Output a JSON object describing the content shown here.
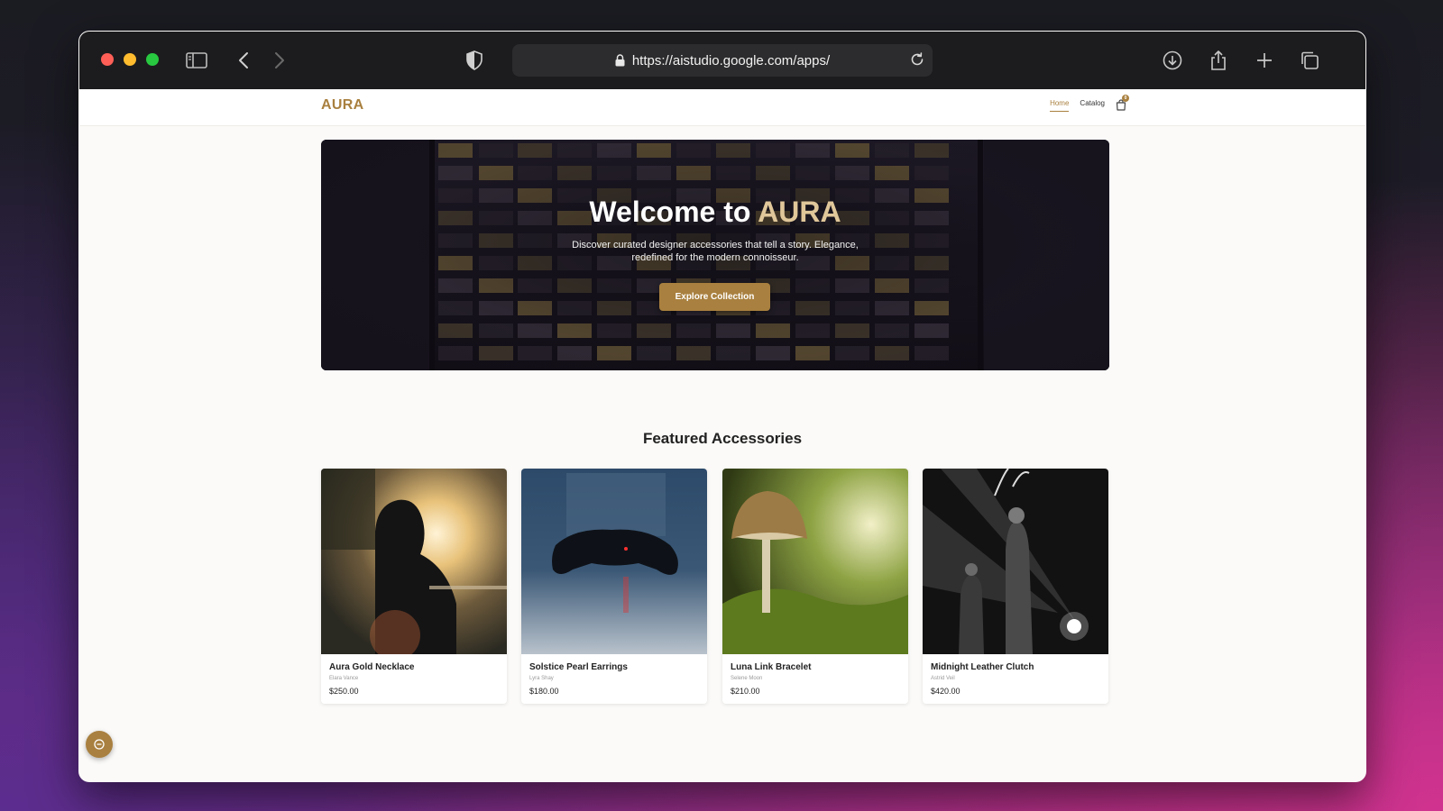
{
  "browser": {
    "url": "https://aistudio.google.com/apps/",
    "icons": [
      "sidebar-icon",
      "back-icon",
      "forward-icon",
      "shield-icon",
      "lock-icon",
      "reload-icon",
      "download-icon",
      "share-icon",
      "new-tab-icon",
      "tabs-icon"
    ]
  },
  "site": {
    "logo": "AURA",
    "nav": {
      "home": "Home",
      "catalog": "Catalog",
      "cart_count": "0"
    }
  },
  "hero": {
    "title_prefix": "Welcome to ",
    "title_accent": "AURA",
    "subtitle": "Discover curated designer accessories that tell a story. Elegance, redefined for the modern connoisseur.",
    "cta": "Explore Collection"
  },
  "featured": {
    "title": "Featured Accessories",
    "products": [
      {
        "name": "Aura Gold Necklace",
        "designer": "Elara Vance",
        "price": "$250.00"
      },
      {
        "name": "Solstice Pearl Earrings",
        "designer": "Lyra Shay",
        "price": "$180.00"
      },
      {
        "name": "Luna Link Bracelet",
        "designer": "Selene Moon",
        "price": "$210.00"
      },
      {
        "name": "Midnight Leather Clutch",
        "designer": "Astrid Veil",
        "price": "$420.00"
      }
    ]
  },
  "colors": {
    "accent": "#a9803f",
    "accent_light": "#e0c79a"
  }
}
